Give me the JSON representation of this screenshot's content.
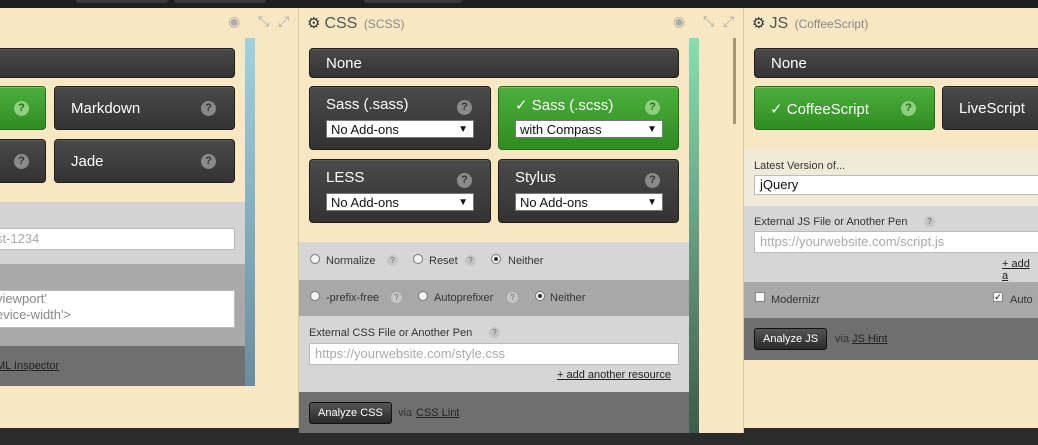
{
  "html_panel": {
    "buttons": [
      {
        "label": "Markdown",
        "q": "?"
      },
      {
        "label": "Jade",
        "q": "?"
      },
      {
        "label": "",
        "q": "?"
      },
      {
        "label": "",
        "q": "?"
      }
    ],
    "class_placeholder": "st-1234",
    "meta_lines": [
      "viewport'",
      "evice-width'>"
    ],
    "inspector_link": "ML Inspector"
  },
  "css_panel": {
    "title": "CSS",
    "subtitle": "(SCSS)",
    "none_label": "None",
    "preprocessors": [
      {
        "label": "Sass (.sass)",
        "addon": "No Add-ons",
        "selected": false
      },
      {
        "label": "✓ Sass (.scss)",
        "addon": "with Compass",
        "selected": true
      },
      {
        "label": "LESS",
        "addon": "No Add-ons",
        "selected": false
      },
      {
        "label": "Stylus",
        "addon": "No Add-ons",
        "selected": false
      }
    ],
    "reset_options": [
      "Normalize",
      "Reset",
      "Neither"
    ],
    "prefix_options": [
      "-prefix-free",
      "Autoprefixer",
      "Neither"
    ],
    "external_label": "External CSS File or Another Pen",
    "external_placeholder": "https://yourwebsite.com/style.css",
    "add_resource": "+ add another resource",
    "analyze_label": "Analyze CSS",
    "via": "via",
    "lint_link": "CSS Lint"
  },
  "js_panel": {
    "title": "JS",
    "subtitle": "(CoffeeScript)",
    "none_label": "None",
    "preprocessors": [
      {
        "label": "✓ CoffeeScript",
        "q": "?",
        "selected": true
      },
      {
        "label": "LiveScript",
        "selected": false
      }
    ],
    "latest_label": "Latest Version of...",
    "latest_value": "jQuery",
    "external_label": "External JS File or Another Pen",
    "external_placeholder": "https://yourwebsite.com/script.js",
    "add_resource": "+ add a",
    "modernizr_label": "Modernizr",
    "auto_label": "Auto",
    "analyze_label": "Analyze JS",
    "via": "via",
    "hint_link": "JS Hint"
  },
  "icons": {
    "gear": "gear-icon",
    "eye": "eye-icon",
    "collapse": "collapse-icon",
    "expand": "expand-icon"
  },
  "colors": {
    "accent_green": "#3a9d2a",
    "panel_bg": "#f7e8c3",
    "button_dark": "#3a3a3a"
  }
}
